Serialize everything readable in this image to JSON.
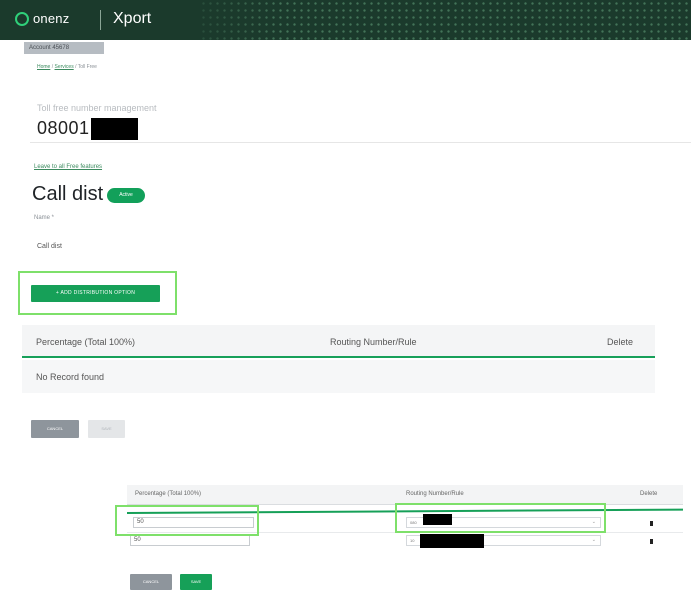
{
  "header": {
    "logo_text": "onenz",
    "app_name": "Xport"
  },
  "account_chip": "Account 45678",
  "breadcrumb": {
    "home": "Home",
    "services": "Services",
    "separator": " / ",
    "current": "Toll Free"
  },
  "management": {
    "label": "Toll free number management",
    "number_prefix": "08001"
  },
  "back_link": "Leave to all Free features",
  "page": {
    "title": "Call dist",
    "status_badge": "Active"
  },
  "name_field": {
    "label": "Name *",
    "value": "Call dist"
  },
  "add_button_label": "+ ADD DISTRIBUTION OPTION",
  "table1": {
    "columns": [
      "Percentage (Total 100%)",
      "Routing Number/Rule",
      "Delete"
    ],
    "empty_text": "No Record found"
  },
  "actions1": {
    "cancel": "CANCEL",
    "save": "SAVE"
  },
  "table2": {
    "columns": [
      "Percentage (Total 100%)",
      "Routing Number/Rule",
      "Delete"
    ],
    "rows": [
      {
        "percentage": "50",
        "routing_prefix": "080"
      },
      {
        "percentage": "50",
        "routing_prefix": "10"
      }
    ]
  },
  "actions2": {
    "cancel": "CANCEL",
    "save": "SAVE"
  },
  "colors": {
    "header_bg": "#1b3a2c",
    "brand_green": "#16a058",
    "highlight": "#7ee06a"
  }
}
